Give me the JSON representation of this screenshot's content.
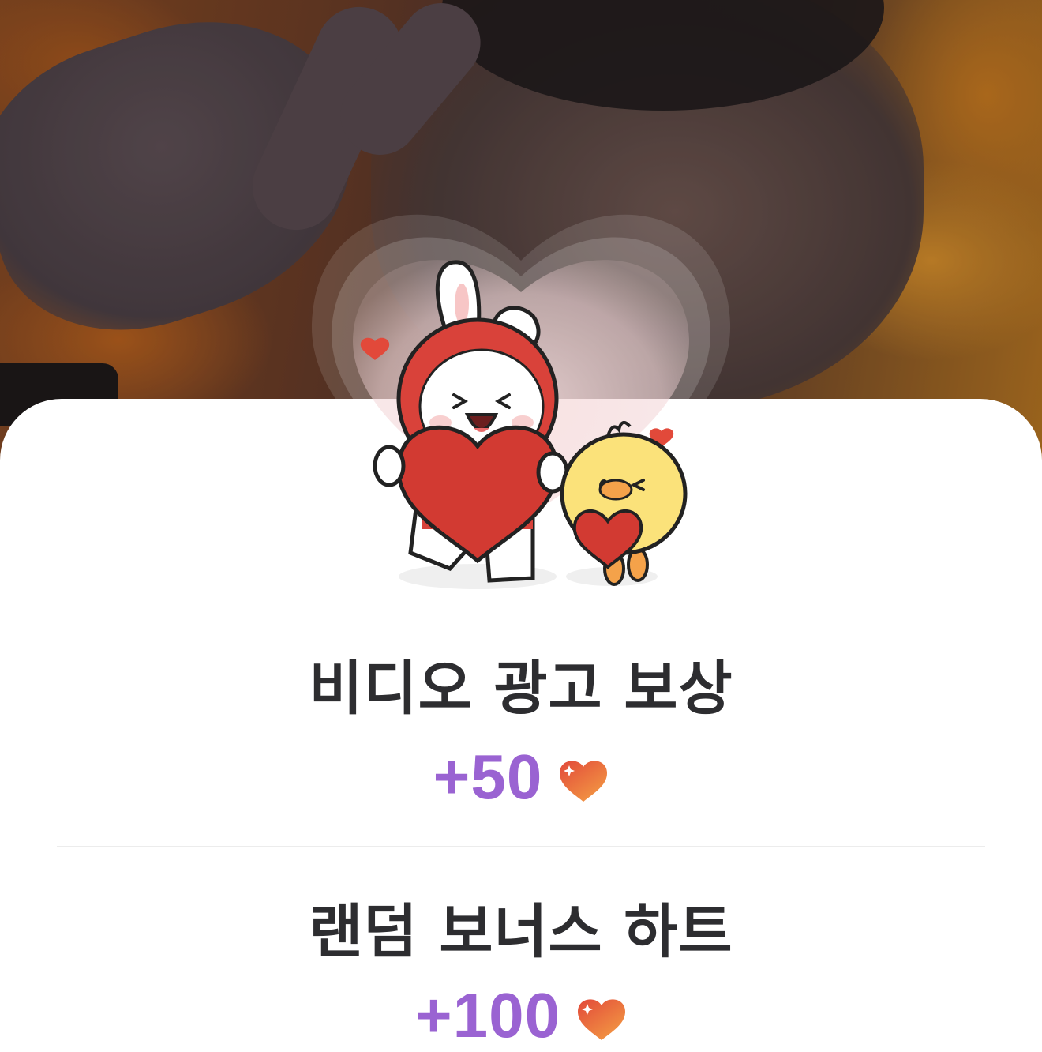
{
  "reward_card": {
    "video_ad_reward": {
      "title": "비디오 광고 보상",
      "amount": "+50"
    },
    "random_bonus": {
      "title": "랜덤 보너스 하트",
      "amount": "+100"
    }
  },
  "colors": {
    "amount_purple": "#9a63d2",
    "title_text": "#2d2d30",
    "heart_red": "#e2493a",
    "heart_orange": "#f39a43"
  },
  "icons": [
    "heart-icon",
    "mascot-illustration"
  ]
}
